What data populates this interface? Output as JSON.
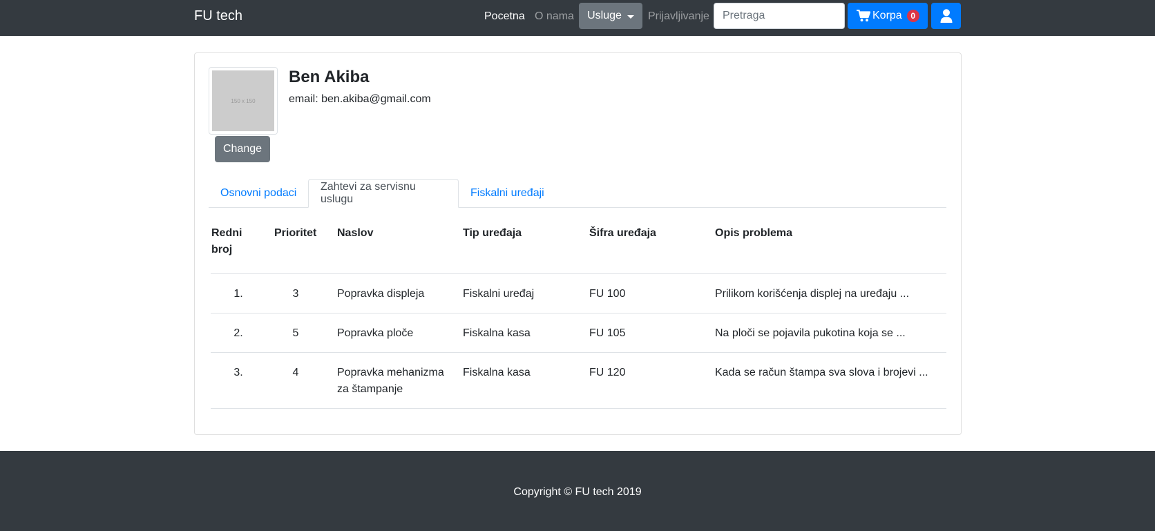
{
  "navbar": {
    "brand": "FU tech",
    "links": {
      "home": "Pocetna",
      "about": "O nama",
      "login": "Prijavljivanje"
    },
    "services_button": "Usluge",
    "search_placeholder": "Pretraga",
    "cart_label": "Korpa",
    "cart_count": "0",
    "user_icon": "user-icon",
    "cart_icon": "shopping-cart-icon"
  },
  "profile": {
    "avatar_placeholder": "150 x 150",
    "change_button": "Change",
    "name": "Ben Akiba",
    "email": "email: ben.akiba@gmail.com"
  },
  "tabs": [
    {
      "label": "Osnovni podaci",
      "active": false
    },
    {
      "label": "Zahtevi za servisnu uslugu",
      "active": true
    },
    {
      "label": "Fiskalni uređaji",
      "active": false
    }
  ],
  "table": {
    "headers": [
      "Redni broj",
      "Prioritet",
      "Naslov",
      "Tip uređaja",
      "Šifra uređaja",
      "Opis problema"
    ],
    "rows": [
      [
        "1.",
        "3",
        "Popravka displeja",
        "Fiskalni uređaj",
        "FU 100",
        "Prilikom korišćenja displej na uređaju ..."
      ],
      [
        "2.",
        "5",
        "Popravka ploče",
        "Fiskalna kasa",
        "FU 105",
        "Na ploči se pojavila pukotina koja se ..."
      ],
      [
        "3.",
        "4",
        "Popravka mehanizma za štampanje",
        "Fiskalna kasa",
        "FU 120",
        "Kada se račun štampa sva slova i brojevi ..."
      ]
    ]
  },
  "footer": {
    "copyright": "Copyright © FU tech 2019"
  },
  "colors": {
    "navbar_bg": "#343a40",
    "primary": "#007bff",
    "secondary": "#6c757d",
    "badge": "#dc3545"
  }
}
